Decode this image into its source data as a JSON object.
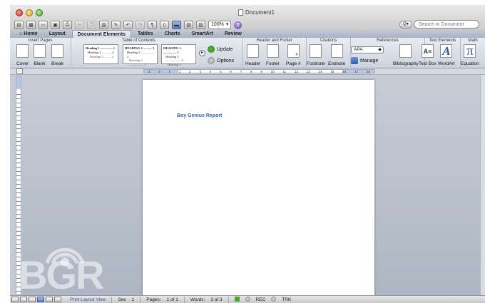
{
  "window": {
    "title": "Document1"
  },
  "toolbar": {
    "buttons": [
      "new-document-icon",
      "templates-icon",
      "open-icon",
      "save-icon",
      "print-icon",
      "cut-icon",
      "copy-icon",
      "paste-icon",
      "format-painter-icon",
      "undo-icon",
      "redo-icon",
      "pilcrow-icon",
      "sidebar-icon",
      "gallery-icon",
      "toolbox-icon",
      "media-browser-icon"
    ],
    "zoom": "100%",
    "help_symbol": "?"
  },
  "search": {
    "placeholder": "Search in Document",
    "scope_label": "Q▾"
  },
  "tabs": [
    {
      "label": "Home",
      "active": false
    },
    {
      "label": "Layout",
      "active": false
    },
    {
      "label": "Document Elements",
      "active": true
    },
    {
      "label": "Tables",
      "active": false
    },
    {
      "label": "Charts",
      "active": false
    },
    {
      "label": "SmartArt",
      "active": false
    },
    {
      "label": "Review",
      "active": false
    }
  ],
  "ribbon": {
    "insert_pages": {
      "title": "Insert Pages",
      "cover": "Cover",
      "blank": "Blank",
      "break": "Break"
    },
    "toc": {
      "title": "Table of Contents",
      "styles": [
        {
          "l1": "Heading 1 ............... 1",
          "l2": "Heading 2 ............ 2",
          "l3": "Heading 3 ......... 3"
        },
        {
          "l1": "HEADING 1 ........... 1",
          "l2": "Heading 2 .................. 2",
          "l3": "Heading 3 .................. 3"
        },
        {
          "l1": "HEADING 1 ................ 1",
          "l2": "Heading 2 ................... 2",
          "l3": "Heading 3 ................. 3"
        }
      ],
      "next_symbol": "▸",
      "update": "Update",
      "options": "Options"
    },
    "header_footer": {
      "title": "Header and Footer",
      "header": "Header",
      "footer": "Footer",
      "page_num": "Page #"
    },
    "citations": {
      "title": "Citations",
      "footnote": "Footnote",
      "endnote": "Endnote"
    },
    "references": {
      "title": "References",
      "style": "APA",
      "manage": "Manage",
      "bibliography": "Bibliography"
    },
    "text_elements": {
      "title": "Text Elements",
      "textbox": "Text Box",
      "wordart": "WordArt",
      "textbox_glyph": "A≡",
      "wordart_glyph": "A"
    },
    "math": {
      "title": "Math",
      "equation": "Equation",
      "glyph": "π"
    }
  },
  "ruler": {
    "tab_selector": "⌐",
    "labels": [
      "3",
      "2",
      "1",
      "1",
      "2",
      "3",
      "4",
      "5",
      "6",
      "7",
      "8",
      "9",
      "10",
      "11",
      "12",
      "13",
      "14",
      "15",
      "16",
      "17",
      "18"
    ]
  },
  "document": {
    "heading": "Boy Genius Report"
  },
  "status": {
    "view": "Print Layout View",
    "section_label": "Sec",
    "section": "1",
    "pages_label": "Pages:",
    "pages": "1 of 1",
    "words_label": "Words:",
    "words": "3 of 3",
    "rec": "REC",
    "trk": "TRK"
  },
  "watermark": {
    "text": "BGR"
  }
}
